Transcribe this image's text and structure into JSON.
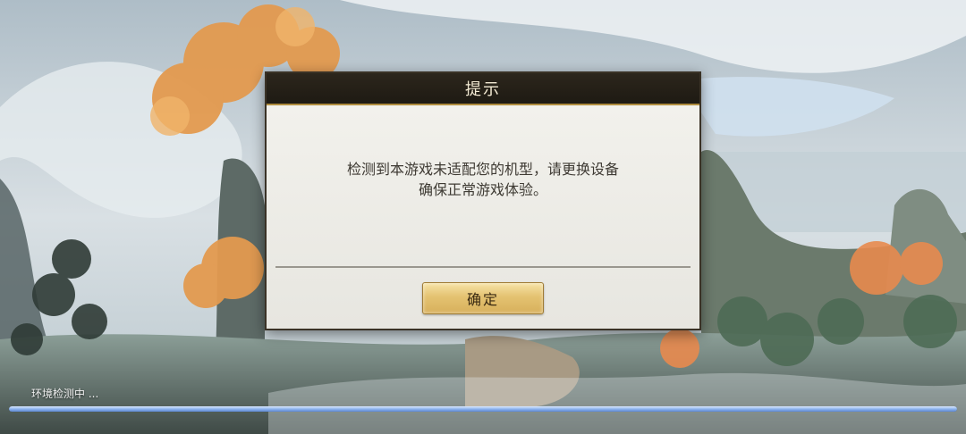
{
  "dialog": {
    "title": "提示",
    "message_line1": "检测到本游戏未适配您的机型，请更换设备",
    "message_line2": "确保正常游戏体验。",
    "confirm_label": "确定"
  },
  "loading": {
    "status_text": "环境检测中 ...",
    "progress_fraction": 1.0
  },
  "colors": {
    "header_bg": "#1e1a13",
    "header_border": "#b08d3f",
    "button_gold": "#e4c271",
    "progress_blue": "#8fb5f0"
  }
}
